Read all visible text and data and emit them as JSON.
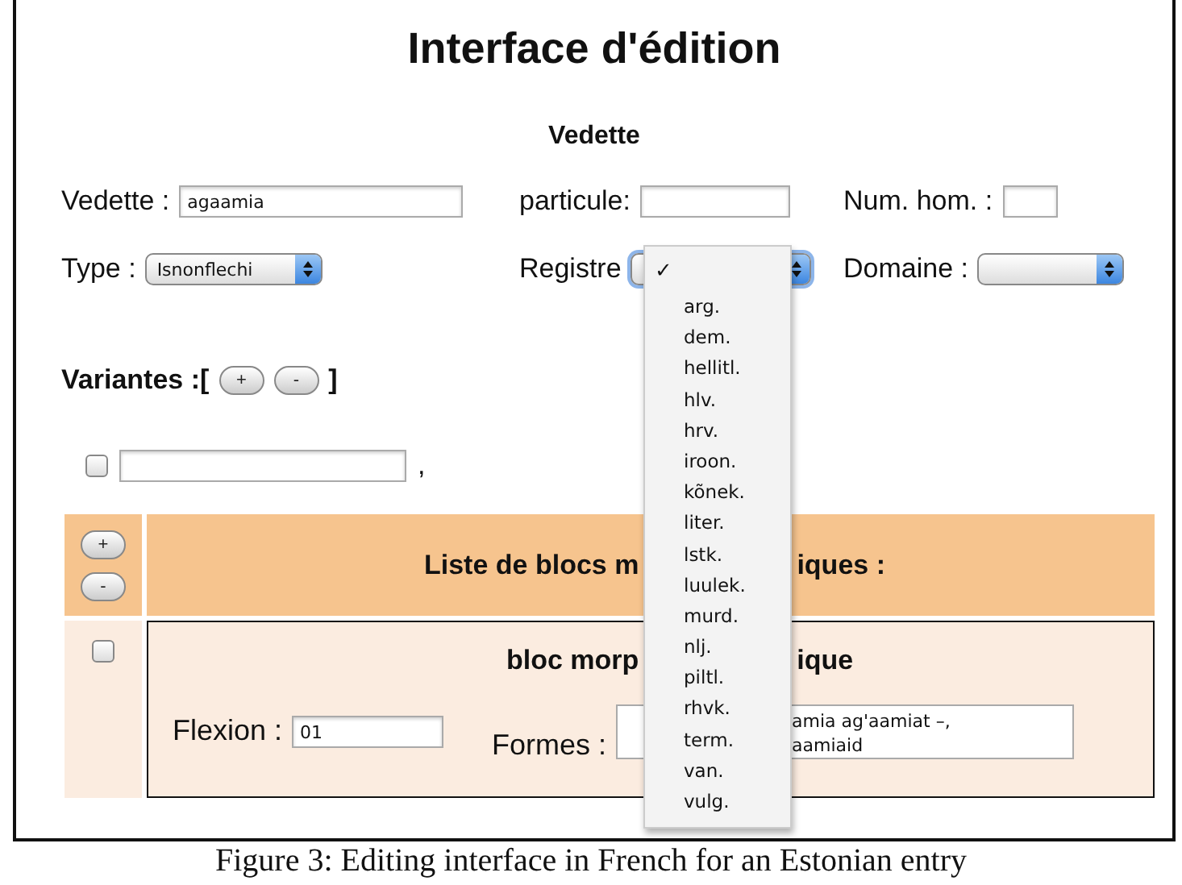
{
  "title": "Interface d'édition",
  "section": "Vedette",
  "fields": [
    {
      "label": "Vedette :",
      "value": "agaamia"
    },
    {
      "label": "particule:"
    },
    {
      "label": "Num. hom. :"
    }
  ],
  "selects": [
    {
      "label": "Type :",
      "value": "Isnonflechi",
      "open": false
    },
    {
      "label": "Registre",
      "open": true
    },
    {
      "label": "Domaine :",
      "open": false
    }
  ],
  "variants": {
    "label": "Variantes :[",
    "close": "]",
    "buttons": [
      "+",
      "-"
    ],
    "items": [
      {
        "checked": false,
        "separator": ","
      }
    ]
  },
  "menu": {
    "blank_selected": true,
    "check": "✓",
    "options": [
      {
        "label": "arg.",
        "selected": false
      },
      {
        "label": "dem.",
        "selected": false
      },
      {
        "label": "hellitl.",
        "selected": false
      },
      {
        "label": "hlv.",
        "selected": false
      },
      {
        "label": "hrv.",
        "selected": false
      },
      {
        "label": "iroon.",
        "selected": false
      },
      {
        "label": "kõnek.",
        "selected": false
      },
      {
        "label": "liter.",
        "selected": false
      },
      {
        "label": "lstk.",
        "selected": false
      },
      {
        "label": "luulek.",
        "selected": false
      },
      {
        "label": "murd.",
        "selected": false
      },
      {
        "label": "nlj.",
        "selected": false
      },
      {
        "label": "piltl.",
        "selected": false
      },
      {
        "label": "rhvk.",
        "selected": false
      },
      {
        "label": "term.",
        "selected": false
      },
      {
        "label": "van.",
        "selected": false
      },
      {
        "label": "vulg.",
        "selected": false
      }
    ]
  },
  "blocks": {
    "buttons": [
      "+",
      "-"
    ],
    "heading_parts": [
      "Liste de blocs m",
      "iques :"
    ],
    "items": [
      {
        "checked": false,
        "title_parts": [
          "bloc morp",
          "ique"
        ],
        "flexion_label": "Flexion :",
        "flexion": "01",
        "formes_label": "Formes :",
        "formes_lines": [
          "amia ag'aamiat –,",
          "aamiaid"
        ]
      }
    ]
  },
  "caption": "Figure 3:  Editing interface in French for an Estonian entry"
}
